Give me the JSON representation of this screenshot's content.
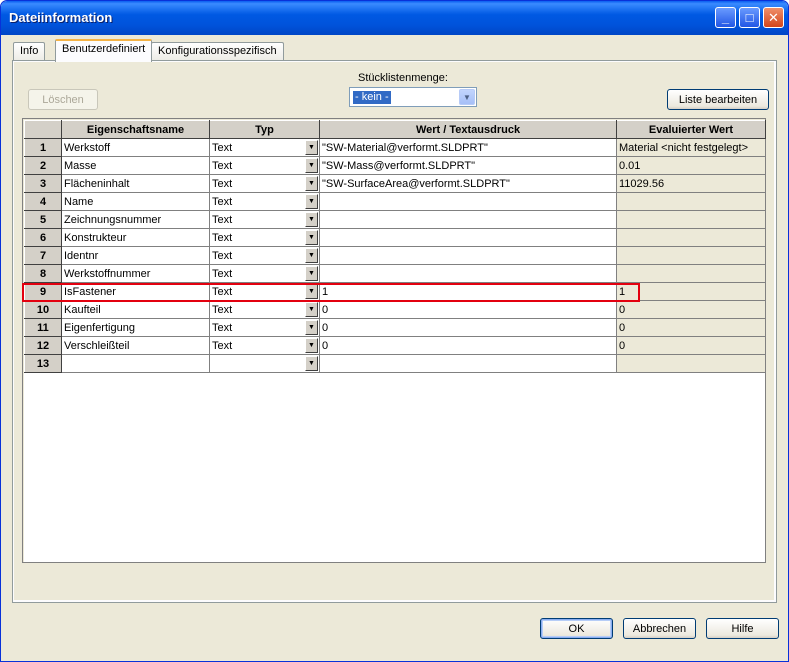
{
  "window": {
    "title": "Dateiinformation",
    "buttons": {
      "minimize": "_",
      "maximize": "□",
      "close": "✕"
    }
  },
  "tabs": [
    {
      "label": "Info",
      "active": false
    },
    {
      "label": "Benutzerdefiniert",
      "active": true
    },
    {
      "label": "Konfigurationsspezifisch",
      "active": false
    }
  ],
  "toolbar": {
    "delete_label": "Löschen",
    "bom_label": "Stücklistenmenge:",
    "bom_value": "- kein -",
    "edit_list_label": "Liste bearbeiten"
  },
  "table": {
    "headers": [
      "Eigenschaftsname",
      "Typ",
      "Wert / Textausdruck",
      "Evaluierter Wert"
    ],
    "rows": [
      {
        "num": "1",
        "name": "Werkstoff",
        "type": "Text",
        "value": "\"SW-Material@verformt.SLDPRT\"",
        "evaluated": "Material <nicht festgelegt>"
      },
      {
        "num": "2",
        "name": "Masse",
        "type": "Text",
        "value": "\"SW-Mass@verformt.SLDPRT\"",
        "evaluated": "0.01"
      },
      {
        "num": "3",
        "name": "Flächeninhalt",
        "type": "Text",
        "value": "\"SW-SurfaceArea@verformt.SLDPRT\"",
        "evaluated": "11029.56"
      },
      {
        "num": "4",
        "name": "Name",
        "type": "Text",
        "value": "",
        "evaluated": ""
      },
      {
        "num": "5",
        "name": "Zeichnungsnummer",
        "type": "Text",
        "value": "",
        "evaluated": ""
      },
      {
        "num": "6",
        "name": "Konstrukteur",
        "type": "Text",
        "value": "",
        "evaluated": ""
      },
      {
        "num": "7",
        "name": "Identnr",
        "type": "Text",
        "value": "",
        "evaluated": ""
      },
      {
        "num": "8",
        "name": "Werkstoffnummer",
        "type": "Text",
        "value": "",
        "evaluated": ""
      },
      {
        "num": "9",
        "name": "IsFastener",
        "type": "Text",
        "value": "1",
        "evaluated": "1"
      },
      {
        "num": "10",
        "name": "Kaufteil",
        "type": "Text",
        "value": "0",
        "evaluated": "0"
      },
      {
        "num": "11",
        "name": "Eigenfertigung",
        "type": "Text",
        "value": "0",
        "evaluated": "0"
      },
      {
        "num": "12",
        "name": "Verschleißteil",
        "type": "Text",
        "value": "0",
        "evaluated": "0"
      },
      {
        "num": "13",
        "name": "",
        "type": "",
        "value": "",
        "evaluated": ""
      }
    ]
  },
  "footer": {
    "ok_label": "OK",
    "cancel_label": "Abbrechen",
    "help_label": "Hilfe"
  },
  "colors": {
    "highlight": "#e3000f",
    "selection": "#316ac5"
  }
}
